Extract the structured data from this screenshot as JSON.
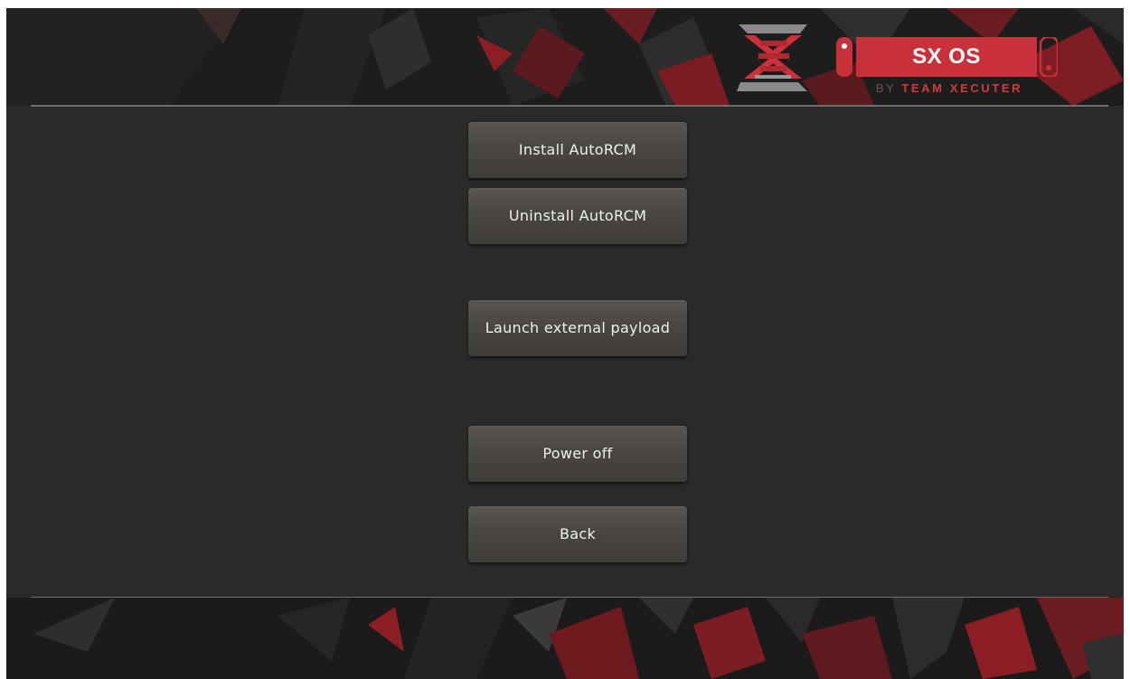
{
  "brand": {
    "title": "SX OS",
    "subtitle_by": "BY",
    "subtitle_team": "TEAM XECUTER",
    "emblem_icon": "sx-emblem-icon",
    "pill_icon": "switch-console-icon"
  },
  "menu": {
    "install_autorcm": "Install AutoRCM",
    "uninstall_autorcm": "Uninstall AutoRCM",
    "launch_payload": "Launch external payload",
    "power_off": "Power off",
    "back": "Back"
  },
  "colors": {
    "accent_red": "#c8313a",
    "background": "#2a2a2a",
    "button": "#4a4641",
    "divider": "#6e6e6e"
  }
}
